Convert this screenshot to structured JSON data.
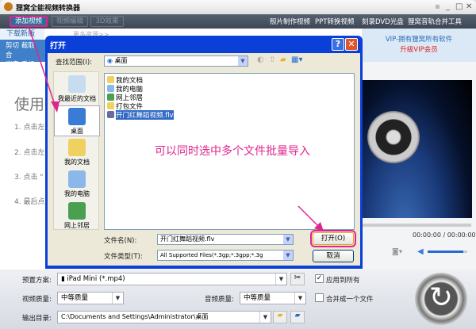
{
  "app": {
    "title": "狸窝全能视频转换器"
  },
  "toolbar": {
    "add_video": "添加视频",
    "edit_video": "视频编辑",
    "effect_3d": "3D效果",
    "links": [
      "照片制作视频",
      "PPT转换视频",
      "刻录DVD光盘",
      "狸窝音轨合并工具"
    ]
  },
  "left": {
    "download_tab": "下载新版",
    "more": "更多资源>>",
    "strip_row1": "剪切 截取 合",
    "strip_row2": "消音 手机 片",
    "usage_title": "使用",
    "steps": [
      "1. 点击左",
      "2. 点击左",
      "3. 点击 \"",
      "4. 最后点"
    ]
  },
  "vip": {
    "line1": "VIP-拥有狸窝所有软件",
    "line2": "升级VIP会员"
  },
  "player": {
    "time": "00:00:00 / 00:00:00",
    "volume": 0.9
  },
  "dialog": {
    "title": "打开",
    "lookin_label": "查找范围(I):",
    "lookin_value": "桌面",
    "places": [
      "我最近的文档",
      "桌面",
      "我的文档",
      "我的电脑",
      "网上邻居"
    ],
    "files": [
      "我的文档",
      "我的电脑",
      "网上邻居",
      "打包文件",
      "开门红舞蹈视频.flv"
    ],
    "filename_label": "文件名(N):",
    "filename_value": "开门红舞蹈视频.flv",
    "filetype_label": "文件类型(T):",
    "filetype_value": "All Supported Files(*.3gp;*.3gpp;*.3g",
    "open_btn": "打开(O)",
    "cancel_btn": "取消"
  },
  "annotation": "可以同时选中多个文件批量导入",
  "bottom": {
    "preset_label": "预置方案:",
    "preset_value": "iPad Mini (*.mp4)",
    "apply_all": "应用到所有",
    "apply_all_checked": true,
    "video_quality_label": "视频质量:",
    "video_quality": "中等质量",
    "audio_quality_label": "音频质量:",
    "audio_quality": "中等质量",
    "merge": "合并成一个文件",
    "merge_checked": false,
    "output_label": "输出目录:",
    "output_value": "C:\\Documents and Settings\\Administrator\\桌面"
  },
  "colors": {
    "highlight": "#e0248e",
    "dialog_frame": "#0a3fd8"
  }
}
